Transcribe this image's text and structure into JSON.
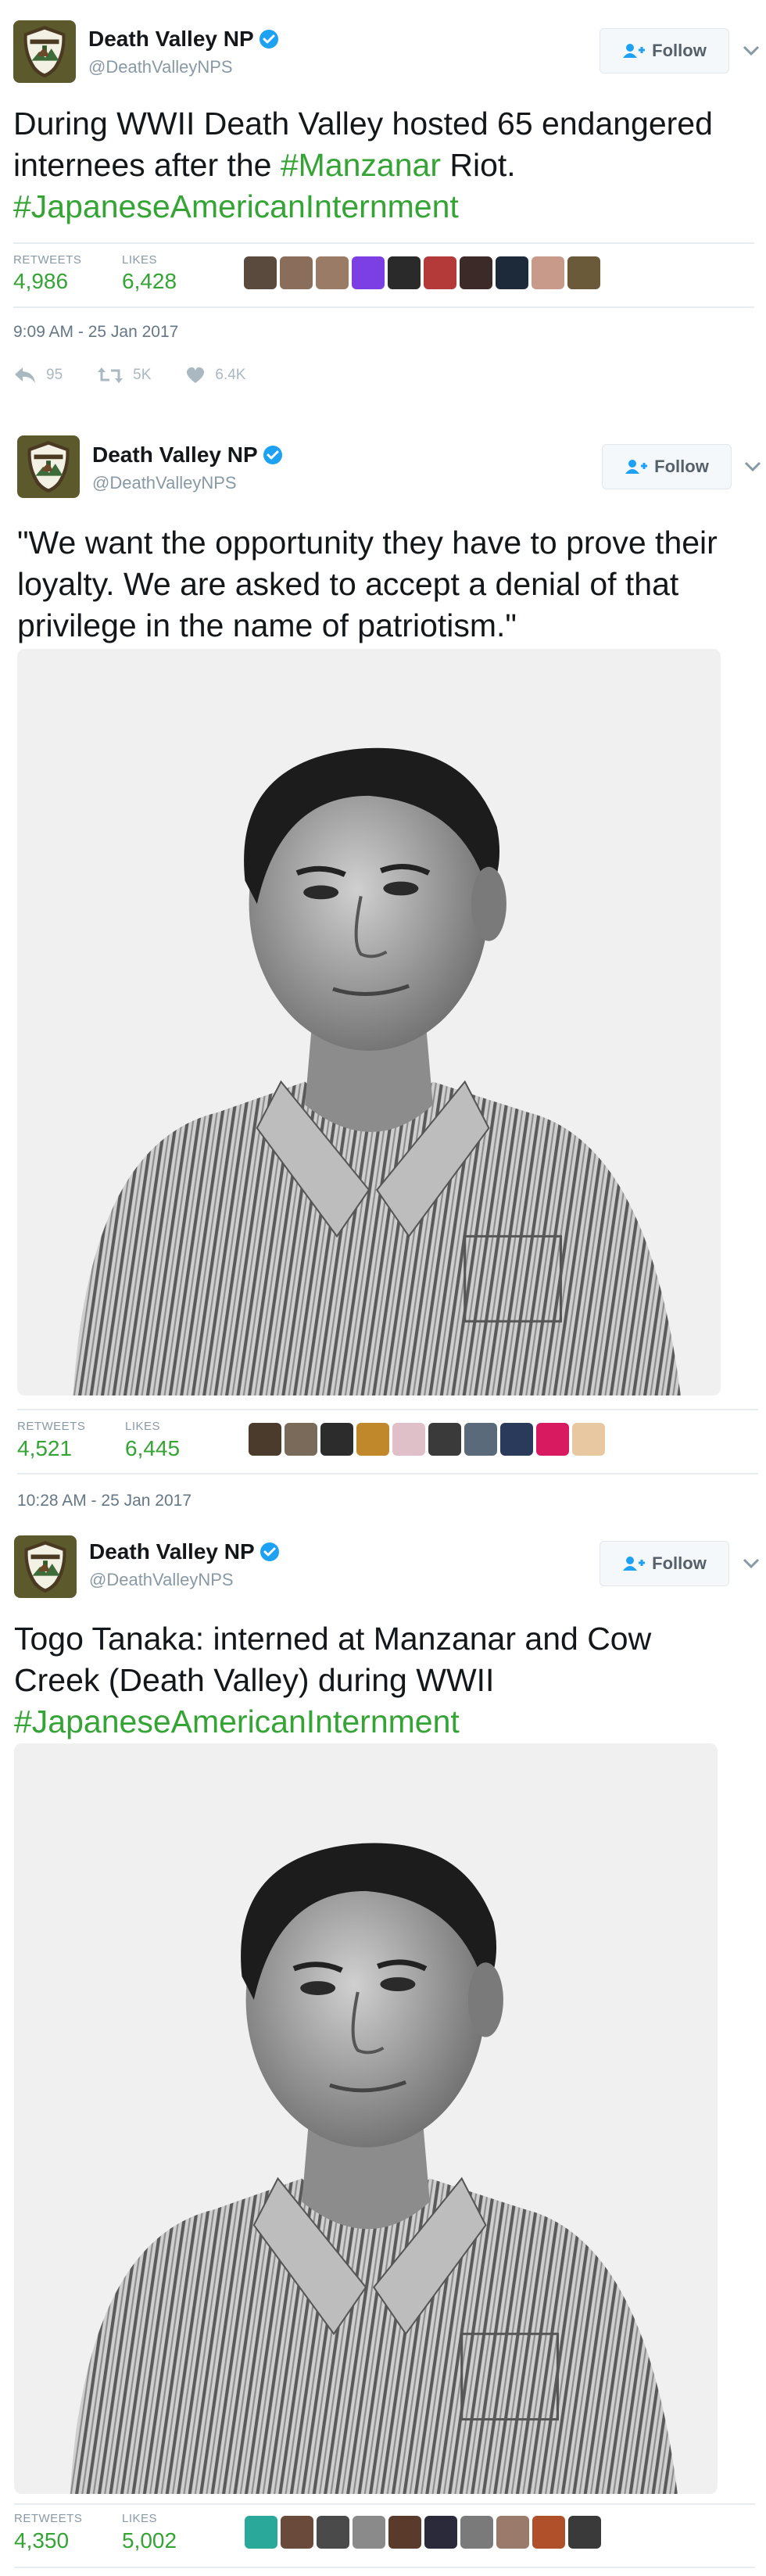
{
  "colors": {
    "accent": "#34a434",
    "muted": "#8899a6",
    "divider": "#e6ecf0"
  },
  "tweets": [
    {
      "author": {
        "name": "Death Valley NP",
        "handle": "@DeathValleyNPS"
      },
      "follow_label": "Follow",
      "text_parts": [
        "During WWII Death Valley hosted 65 endangered internees after the ",
        "#Manzanar",
        " Riot. ",
        "#JapaneseAmericanInternment"
      ],
      "retweets_label": "RETWEETS",
      "retweets": "4,986",
      "likes_label": "LIKES",
      "likes": "6,428",
      "timestamp": "9:09 AM - 25 Jan 2017",
      "replies": "95",
      "retweet_count": "5K",
      "like_count": "6.4K"
    },
    {
      "author": {
        "name": "Death Valley NP",
        "handle": "@DeathValleyNPS"
      },
      "follow_label": "Follow",
      "text": "\"We want the opportunity they have to prove their loyalty. We are asked to accept a denial of that privilege in the name of patriotism.\"",
      "retweets_label": "RETWEETS",
      "retweets": "4,521",
      "likes_label": "LIKES",
      "likes": "6,445",
      "timestamp": "10:28 AM - 25 Jan 2017"
    },
    {
      "author": {
        "name": "Death Valley NP",
        "handle": "@DeathValleyNPS"
      },
      "follow_label": "Follow",
      "text_parts": [
        "Togo Tanaka: interned at Manzanar and Cow Creek (Death Valley) during WWII ",
        "#JapaneseAmericanInternment"
      ],
      "retweets_label": "RETWEETS",
      "retweets": "4,350",
      "likes_label": "LIKES",
      "likes": "5,002"
    }
  ]
}
